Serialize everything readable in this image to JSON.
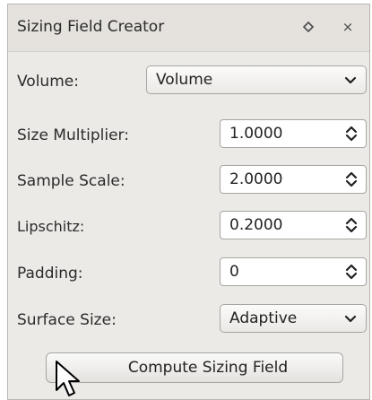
{
  "panel": {
    "title": "Sizing Field Creator",
    "float_icon": "float-icon",
    "close_icon": "close-icon",
    "close_glyph": "×"
  },
  "volume": {
    "label": "Volume:",
    "value": "Volume"
  },
  "size_multiplier": {
    "label": "Size Multiplier:",
    "value": "1.0000"
  },
  "sample_scale": {
    "label": "Sample Scale:",
    "value": "2.0000"
  },
  "lipschitz": {
    "label": "Lipschitz:",
    "value": "0.2000"
  },
  "padding": {
    "label": "Padding:",
    "value": "0"
  },
  "surface_size": {
    "label": "Surface Size:",
    "value": "Adaptive"
  },
  "compute_button": {
    "label": "Compute Sizing Field"
  },
  "colors": {
    "panel_bg": "#eceae7",
    "border": "#a8a5a0"
  }
}
